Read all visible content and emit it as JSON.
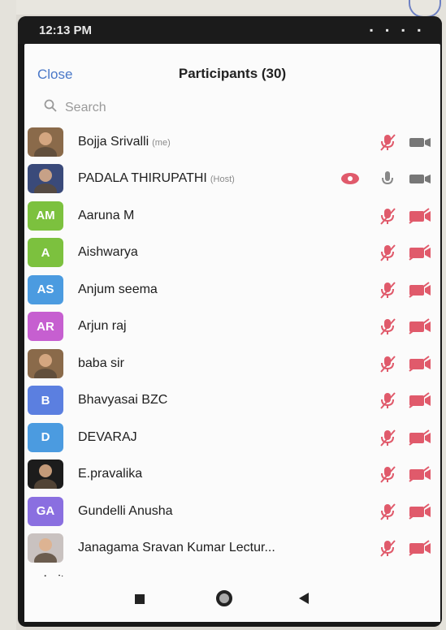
{
  "status_bar": {
    "time": "12:13 PM",
    "right_text": ""
  },
  "header": {
    "close_label": "Close",
    "title": "Participants (30)"
  },
  "search": {
    "placeholder": "Search"
  },
  "colors": {
    "accent": "#4a78c8",
    "muted_red": "#e05a6b"
  },
  "participants": [
    {
      "name": "Bojja Srivalli",
      "tag": "(me)",
      "avatar_text": "",
      "avatar_color": "#8a6a4a",
      "avatar_type": "photo"
    },
    {
      "name": "PADALA THIRUPATHI",
      "tag": "(Host)",
      "avatar_text": "",
      "avatar_color": "#3a4a7a",
      "avatar_type": "photo"
    },
    {
      "name": "Aaruna M",
      "tag": "",
      "avatar_text": "AM",
      "avatar_color": "#7cc13e",
      "avatar_type": "initials"
    },
    {
      "name": "Aishwarya",
      "tag": "",
      "avatar_text": "A",
      "avatar_color": "#7cc13e",
      "avatar_type": "initials"
    },
    {
      "name": "Anjum seema",
      "tag": "",
      "avatar_text": "AS",
      "avatar_color": "#4b9be0",
      "avatar_type": "initials"
    },
    {
      "name": "Arjun raj",
      "tag": "",
      "avatar_text": "AR",
      "avatar_color": "#c65fd0",
      "avatar_type": "initials"
    },
    {
      "name": "baba sir",
      "tag": "",
      "avatar_text": "",
      "avatar_color": "#8a6a4a",
      "avatar_type": "photo"
    },
    {
      "name": "Bhavyasai  BZC",
      "tag": "",
      "avatar_text": "B",
      "avatar_color": "#5b7fe0",
      "avatar_type": "initials"
    },
    {
      "name": "DEVARAJ",
      "tag": "",
      "avatar_text": "D",
      "avatar_color": "#4b9be0",
      "avatar_type": "initials"
    },
    {
      "name": "E.pravalika",
      "tag": "",
      "avatar_text": "",
      "avatar_color": "#1c1c1c",
      "avatar_type": "photo"
    },
    {
      "name": "Gundelli Anusha",
      "tag": "",
      "avatar_text": "GA",
      "avatar_color": "#8a6fe0",
      "avatar_type": "initials"
    },
    {
      "name": "Janagama Sravan Kumar Lectur...",
      "tag": "",
      "avatar_text": "",
      "avatar_color": "#c9c2c0",
      "avatar_type": "photo"
    }
  ],
  "footer": {
    "invite_label": "Invite"
  }
}
